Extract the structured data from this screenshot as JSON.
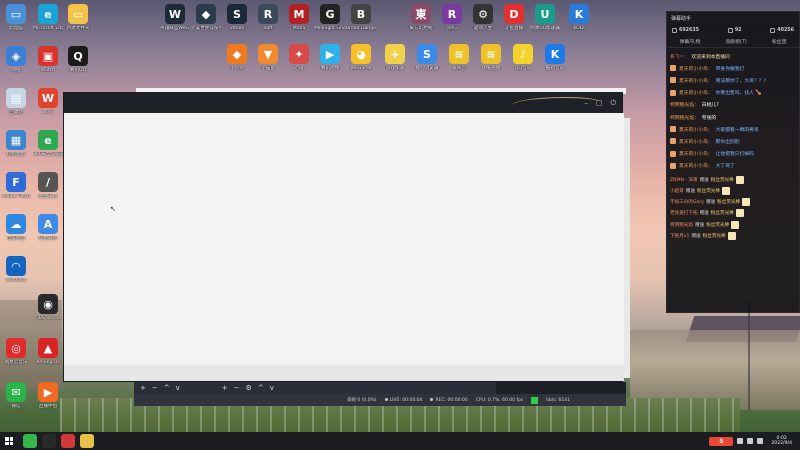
{
  "desktop": {
    "left_icons": [
      {
        "label": "此电脑",
        "color": "#4a90d9",
        "glyph": "▭"
      },
      {
        "label": "Microsoft Edge",
        "color": "#1aa3d6",
        "glyph": "e"
      },
      {
        "label": "新建文件夹",
        "color": "#f3c34a",
        "glyph": "▭"
      },
      {
        "label": "网络",
        "color": "#3d7fd6",
        "glyph": "◈"
      },
      {
        "label": "Watch",
        "color": "#d8342b",
        "glyph": "▣"
      },
      {
        "label": "腾讯QQ",
        "color": "#1b1b1b",
        "glyph": "Q"
      },
      {
        "label": "回收站",
        "color": "#c5d6e6",
        "glyph": "▤"
      },
      {
        "label": "WPS",
        "color": "#e1442e",
        "glyph": "W"
      },
      {
        "label": "控制面板",
        "color": "#3b87cf",
        "glyph": "▦"
      },
      {
        "label": "360安全浏览器",
        "color": "#2fa84f",
        "glyph": "e"
      },
      {
        "label": "Adobe Flash",
        "color": "#2f6ad8",
        "glyph": "F"
      },
      {
        "label": "画图工具",
        "color": "#555",
        "glyph": "/"
      },
      {
        "label": "百度网盘",
        "color": "#2f87e0",
        "glyph": "☁"
      },
      {
        "label": "应用商店",
        "color": "#3e8ae6",
        "glyph": "A"
      },
      {
        "label": "Windows",
        "color": "#1565c0",
        "glyph": "◠"
      },
      {
        "label": "OBS Studio",
        "color": "#2a2a2a",
        "glyph": "◉"
      },
      {
        "label": "网易云音乐",
        "color": "#e02b2b",
        "glyph": "◎"
      },
      {
        "label": "Among Us",
        "color": "#d92424",
        "glyph": "▲"
      },
      {
        "label": "微信",
        "color": "#2bb44a",
        "glyph": "✉"
      },
      {
        "label": "直播伴侣",
        "color": "#f06a24",
        "glyph": "▶"
      }
    ],
    "top_icons": [
      {
        "label": "英雄联盟WeGame",
        "color": "#1e2c3a",
        "glyph": "W"
      },
      {
        "label": "完美世界竞技平台",
        "color": "#2a3b4c",
        "glyph": "◆"
      },
      {
        "label": "Steam",
        "color": "#1b2838",
        "glyph": "S"
      },
      {
        "label": "Raft",
        "color": "#3a4a5a",
        "glyph": "R"
      },
      {
        "label": "Mafia",
        "color": "#b52020",
        "glyph": "M"
      },
      {
        "label": "Midnight Ghost Hunt",
        "color": "#222",
        "glyph": "G"
      },
      {
        "label": "Bread Danger",
        "color": "#444",
        "glyph": "B"
      },
      {
        "label": "東方幻想剣",
        "color": "#8a4a6a",
        "glyph": "東"
      },
      {
        "label": "RPG",
        "color": "#7a3aa0",
        "glyph": "R"
      },
      {
        "label": "驱动人生",
        "color": "#333",
        "glyph": "⚙"
      },
      {
        "label": "斗鱼直播",
        "color": "#e03030",
        "glyph": "D"
      },
      {
        "label": "网易UU加速器",
        "color": "#1a9c8c",
        "glyph": "U"
      },
      {
        "label": "KODI",
        "color": "#2a7ad8",
        "glyph": "K"
      }
    ],
    "second_row_icons": [
      {
        "label": "小火箭",
        "color": "#f07a20",
        "glyph": "◆"
      },
      {
        "label": "小猫鱼",
        "color": "#f28a30",
        "glyph": "▼"
      },
      {
        "label": "迅雷",
        "color": "#d84a4a",
        "glyph": "✦"
      },
      {
        "label": "腾讯视频",
        "color": "#2fb0e8",
        "glyph": "▶"
      },
      {
        "label": "WeGame",
        "color": "#f5c02a",
        "glyph": "◕"
      },
      {
        "label": "游戏加速",
        "color": "#f0d24a",
        "glyph": "+"
      },
      {
        "label": "搜狗浏览器",
        "color": "#3a8ae8",
        "glyph": "S"
      },
      {
        "label": "爱奇艺",
        "color": "#f0c22a",
        "glyph": "≋"
      },
      {
        "label": "优酷视频",
        "color": "#f0c22a",
        "glyph": "≋"
      },
      {
        "label": "QQ音乐",
        "color": "#f5d32a",
        "glyph": "♪"
      },
      {
        "label": "酷狗音乐",
        "color": "#1e7ae8",
        "glyph": "K"
      }
    ]
  },
  "obs": {
    "status": {
      "dropped": "丢帧 0 (0.0%)",
      "live": "LIVE: 00:00:04",
      "rec": "REC: 00:00:00",
      "cpu": "CPU: 0.7%, 60.00 fps",
      "bitrate": "kb/s: 6141"
    },
    "toolbar_left": [
      "+",
      "−",
      "^",
      "v"
    ],
    "toolbar_right": [
      "+",
      "−",
      "⚙",
      "^",
      "v"
    ]
  },
  "chat": {
    "title": "弹幕助手",
    "stats": {
      "viewers": "692635",
      "likes": "92",
      "fans": "40256"
    },
    "tabs": [
      "弹幕/礼物",
      "贡献榜(7)",
      "粉丝团"
    ],
    "system_msg": {
      "user": "系飞~：",
      "text": "欢迎来到本直播间"
    },
    "messages": [
      {
        "user": "夏天的小小鸟：",
        "text": "带身你跟我打"
      },
      {
        "user": "夏天的小小鸟：",
        "text": "用法那你了，大哥？？？"
      },
      {
        "user": "夏天的小小鸟：",
        "text": "你要出售吗，找人 🍗"
      },
      {
        "user": "柯明鲍光焰：",
        "text": "白桃儿?",
        "plain": true
      },
      {
        "user": "柯明鲍光焰：",
        "text": "夸张的",
        "plain": true
      },
      {
        "user": "夏天的小小鸟：",
        "text": "大家都看一颗的男哥"
      },
      {
        "user": "夏天的小小鸟：",
        "text": "那你出别别"
      },
      {
        "user": "夏天的小小鸟：",
        "text": "让他把我只打掉吗"
      },
      {
        "user": "夏天的小小鸟：",
        "text": "大丁哥了"
      }
    ],
    "gifts": [
      {
        "user": "ZNMN · 深夜",
        "action": "赠送",
        "gift": "粉丝荧光棒"
      },
      {
        "user": "小超哥",
        "action": "赠送",
        "gift": "粉丝荧光棒"
      },
      {
        "user": "不如三分的Gary",
        "action": "赠送",
        "gift": "粉丝荧光棒"
      },
      {
        "user": "老徐爱打下拓",
        "action": "赠送",
        "gift": "粉丝荧光棒"
      },
      {
        "user": "柯明鲍光焰",
        "action": "赠送",
        "gift": "粉丝荧光棒"
      },
      {
        "user": "下拖月x1",
        "action": "赠送",
        "gift": "粉丝荧光棒"
      }
    ]
  },
  "taskbar": {
    "apps": [
      {
        "name": "wechat",
        "color": "#39b54a"
      },
      {
        "name": "obs",
        "color": "#2a2a2a"
      },
      {
        "name": "netease",
        "color": "#d23a3a"
      },
      {
        "name": "folder",
        "color": "#e8c14a"
      }
    ],
    "tray_logo": "S",
    "time": "0:02",
    "date": "2022/9/4"
  }
}
